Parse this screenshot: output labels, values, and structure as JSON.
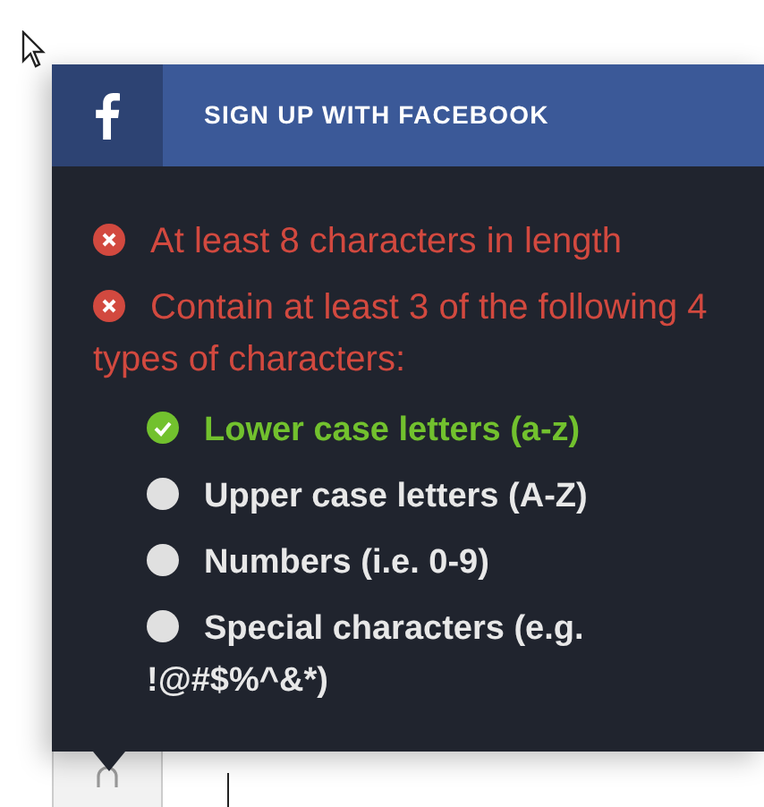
{
  "facebook_button": {
    "label": "SIGN UP WITH FACEBOOK"
  },
  "password_rules": [
    {
      "text": "At least 8 characters in length",
      "met": false
    },
    {
      "text": "Contain at least 3 of the following 4 types of characters:",
      "met": false,
      "children": [
        {
          "text": "Lower case letters (a-z)",
          "met": true
        },
        {
          "text": "Upper case letters (A-Z)",
          "met": false
        },
        {
          "text": "Numbers (i.e. 0-9)",
          "met": false
        },
        {
          "text": "Special characters (e.g. !@#$%^&*)",
          "met": false
        }
      ]
    }
  ]
}
